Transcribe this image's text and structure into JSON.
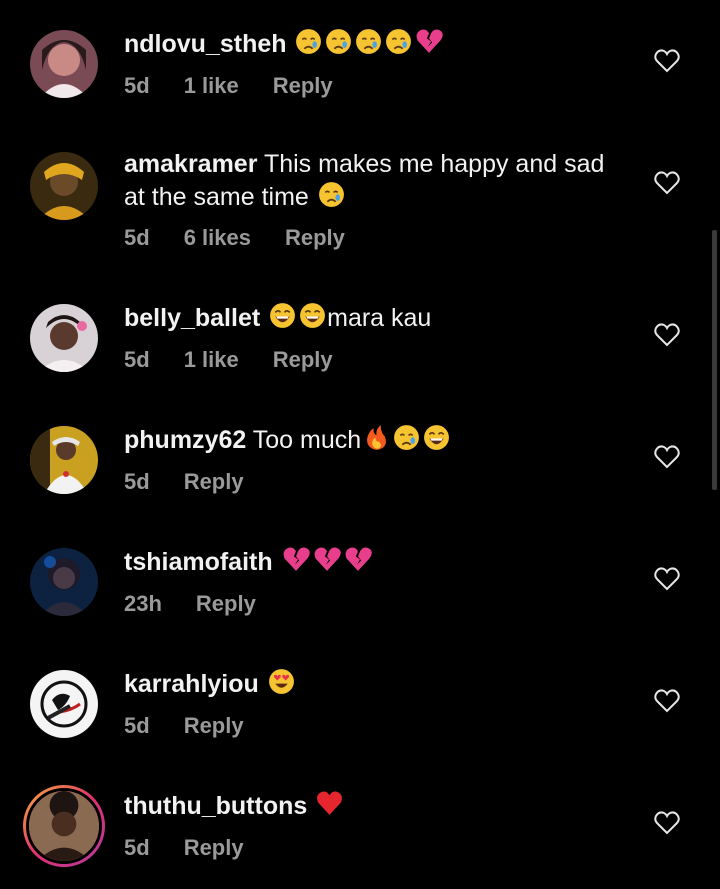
{
  "comments": [
    {
      "username": "ndlovu_stheh",
      "text": "",
      "emojis": [
        "cry",
        "cry",
        "cry",
        "cry",
        "broken-heart"
      ],
      "time": "5d",
      "likes": "1 like",
      "reply": "Reply"
    },
    {
      "username": "amakramer",
      "text": "This makes me happy and sad at the same time",
      "emojis": [
        "cry"
      ],
      "time": "5d",
      "likes": "6 likes",
      "reply": "Reply"
    },
    {
      "username": "belly_ballet",
      "text": "mara kau",
      "emojis_before": [
        "laugh",
        "laugh"
      ],
      "time": "5d",
      "likes": "1 like",
      "reply": "Reply"
    },
    {
      "username": "phumzy62",
      "text": "Too much",
      "emojis": [
        "fire",
        "cry",
        "laugh"
      ],
      "time": "5d",
      "likes": "",
      "reply": "Reply"
    },
    {
      "username": "tshiamofaith",
      "text": "",
      "emojis": [
        "broken-heart",
        "broken-heart",
        "broken-heart"
      ],
      "time": "23h",
      "likes": "",
      "reply": "Reply"
    },
    {
      "username": "karrahlyiou",
      "text": "",
      "emojis": [
        "heart-eyes"
      ],
      "time": "5d",
      "likes": "",
      "reply": "Reply"
    },
    {
      "username": "thuthu_buttons",
      "text": "",
      "emojis": [
        "red-heart"
      ],
      "time": "5d",
      "likes": "",
      "reply": "Reply"
    }
  ],
  "icons": {
    "like": "heart-outline-icon"
  },
  "colors": {
    "background": "#000000",
    "meta": "#9a9a9a",
    "text": "#f2f2f2"
  }
}
